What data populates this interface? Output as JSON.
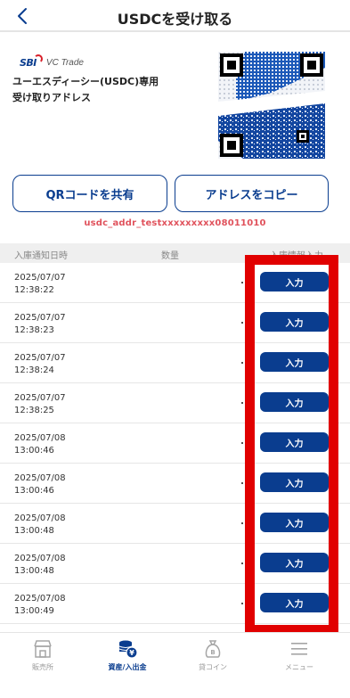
{
  "header": {
    "title": "USDCを受け取る"
  },
  "brand": {
    "logo_text": "SBI VC Trade"
  },
  "receive": {
    "coin_label": "ユーエスディーシー(USDC)専用",
    "address_label": "受け取りアドレス",
    "address": "usdc_addr_testxxxxxxxxx08011010"
  },
  "actions": {
    "share_qr_label": "QRコードを共有",
    "copy_address_label": "アドレスをコピー"
  },
  "table": {
    "columns": {
      "date": "入庫通知日時",
      "quantity": "数量",
      "info": "入庫情報入力"
    },
    "rows": [
      {
        "date": "2025/07/07",
        "time": "12:38:22",
        "button": "入力"
      },
      {
        "date": "2025/07/07",
        "time": "12:38:23",
        "button": "入力"
      },
      {
        "date": "2025/07/07",
        "time": "12:38:24",
        "button": "入力"
      },
      {
        "date": "2025/07/07",
        "time": "12:38:25",
        "button": "入力"
      },
      {
        "date": "2025/07/08",
        "time": "13:00:46",
        "button": "入力"
      },
      {
        "date": "2025/07/08",
        "time": "13:00:46",
        "button": "入力"
      },
      {
        "date": "2025/07/08",
        "time": "13:00:48",
        "button": "入力"
      },
      {
        "date": "2025/07/08",
        "time": "13:00:48",
        "button": "入力"
      },
      {
        "date": "2025/07/08",
        "time": "13:00:49",
        "button": "入力"
      }
    ]
  },
  "tabbar": {
    "shop": "販売所",
    "assets": "資産/入出金",
    "lend": "貸コイン",
    "menu": "メニュー",
    "active": "assets"
  },
  "colors": {
    "brand_blue": "#0a3d8f",
    "address_red": "#e0525c",
    "highlight_red": "#e10000"
  },
  "icons": [
    "back-chevron-icon",
    "qr-code",
    "store-icon",
    "coins-yen-icon",
    "money-bag-bitcoin-icon",
    "hamburger-menu-icon"
  ]
}
